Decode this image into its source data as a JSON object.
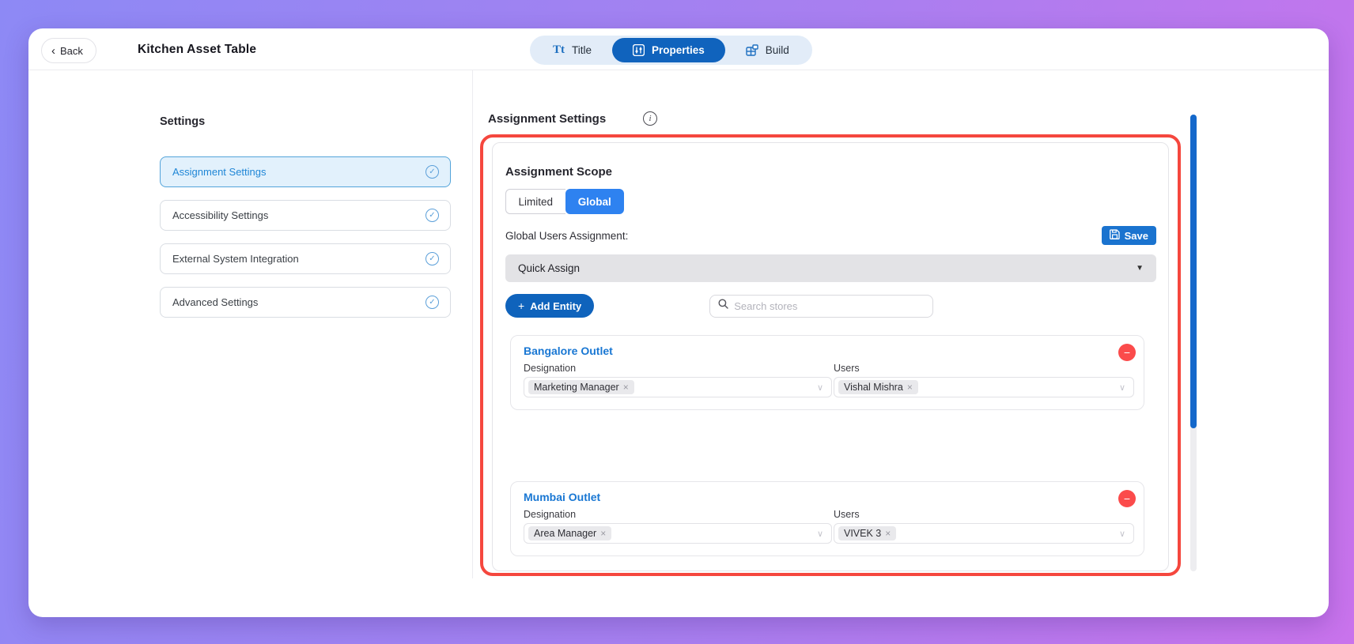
{
  "header": {
    "back_label": "Back",
    "title": "Kitchen Asset Table",
    "tabs": [
      {
        "label": "Title",
        "active": false
      },
      {
        "label": "Properties",
        "active": true
      },
      {
        "label": "Build",
        "active": false
      }
    ]
  },
  "sidebar": {
    "heading": "Settings",
    "items": [
      {
        "label": "Assignment Settings",
        "selected": true,
        "status": "complete"
      },
      {
        "label": "Accessibility Settings",
        "selected": false,
        "status": "complete"
      },
      {
        "label": "External System Integration",
        "selected": false,
        "status": "complete"
      },
      {
        "label": "Advanced Settings",
        "selected": false,
        "status": "complete"
      }
    ]
  },
  "main": {
    "heading": "Assignment Settings",
    "scope": {
      "heading": "Assignment Scope",
      "options": [
        "Limited",
        "Global"
      ],
      "selected": "Global"
    },
    "global_users_label": "Global Users Assignment:",
    "save_label": "Save",
    "quick_assign_value": "Quick Assign",
    "add_entity_label": "Add Entity",
    "search_placeholder": "Search stores",
    "outlets": [
      {
        "name": "Bangalore Outlet",
        "designation_label": "Designation",
        "users_label": "Users",
        "designation_tag": "Marketing Manager",
        "user_tag": "Vishal Mishra"
      },
      {
        "name": "Mumbai Outlet",
        "designation_label": "Designation",
        "users_label": "Users",
        "designation_tag": "Area Manager",
        "user_tag": "VIVEK 3"
      }
    ]
  },
  "icons": {
    "back_chevron": "‹",
    "title_tab_glyph": "Tt",
    "info": "i",
    "check": "✓",
    "plus": "+",
    "minus": "−",
    "close": "×",
    "dropdown_caret": "▼",
    "select_caret": "∨"
  },
  "colors": {
    "background_gradient_start": "#8d89f5",
    "background_gradient_end": "#c973ec",
    "accent_blue": "#2e82f0",
    "dark_blue": "#1063bd",
    "save_blue": "#1a73cf",
    "link_blue": "#1977d3",
    "highlight_red": "#f5473e",
    "remove_red": "#fb4b4b",
    "selected_item_bg": "#e2f1fc",
    "selected_item_border": "#53a4da",
    "tabbar_bg": "#e2ecf8",
    "scrollbar_thumb": "#1468cb"
  }
}
